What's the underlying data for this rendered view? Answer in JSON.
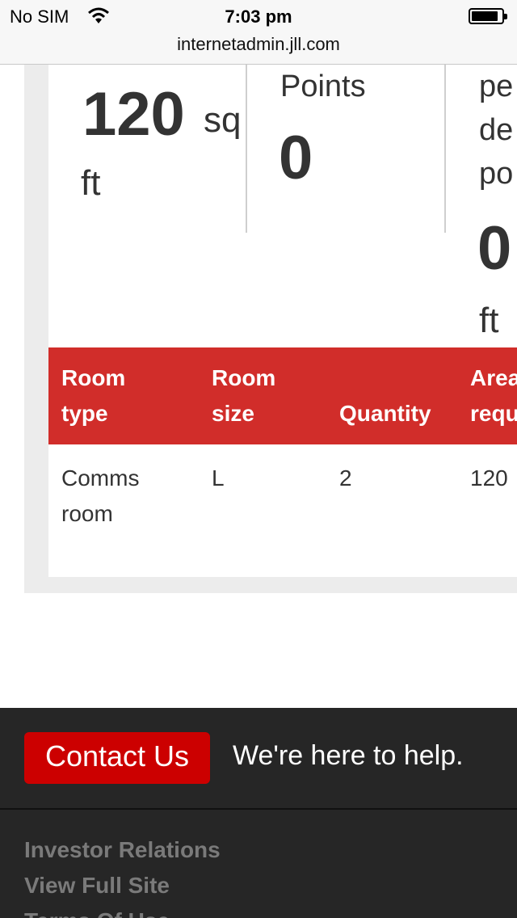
{
  "status_bar": {
    "carrier": "No SIM",
    "time": "7:03 pm",
    "url": "internetadmin.jll.com"
  },
  "stats": {
    "area_value": "120",
    "area_unit_part1": "sq",
    "area_unit_part2": "ft",
    "points_label": "Points",
    "points_value": "0",
    "col3_label_line1": "pe",
    "col3_label_line2": "de",
    "col3_label_line3": "po",
    "col3_value": "0",
    "col3_unit": "ft"
  },
  "table": {
    "headers": [
      {
        "line1": "Room",
        "line2": "type"
      },
      {
        "line1": "Room",
        "line2": "size"
      },
      {
        "line1": "",
        "line2": "Quantity"
      },
      {
        "line1": "Area",
        "line2": "requ"
      }
    ],
    "rows": [
      {
        "room_type_line1": "Comms",
        "room_type_line2": "room",
        "room_size": "L",
        "quantity": "2",
        "area": "120"
      }
    ]
  },
  "footer": {
    "contact_label": "Contact Us",
    "help_text": "We're here to help.",
    "links": [
      "Investor Relations",
      "View Full Site",
      "Terms Of Use"
    ]
  },
  "colors": {
    "accent_red": "#d12d2a",
    "button_red": "#cc0000",
    "footer_bg": "#262626"
  }
}
